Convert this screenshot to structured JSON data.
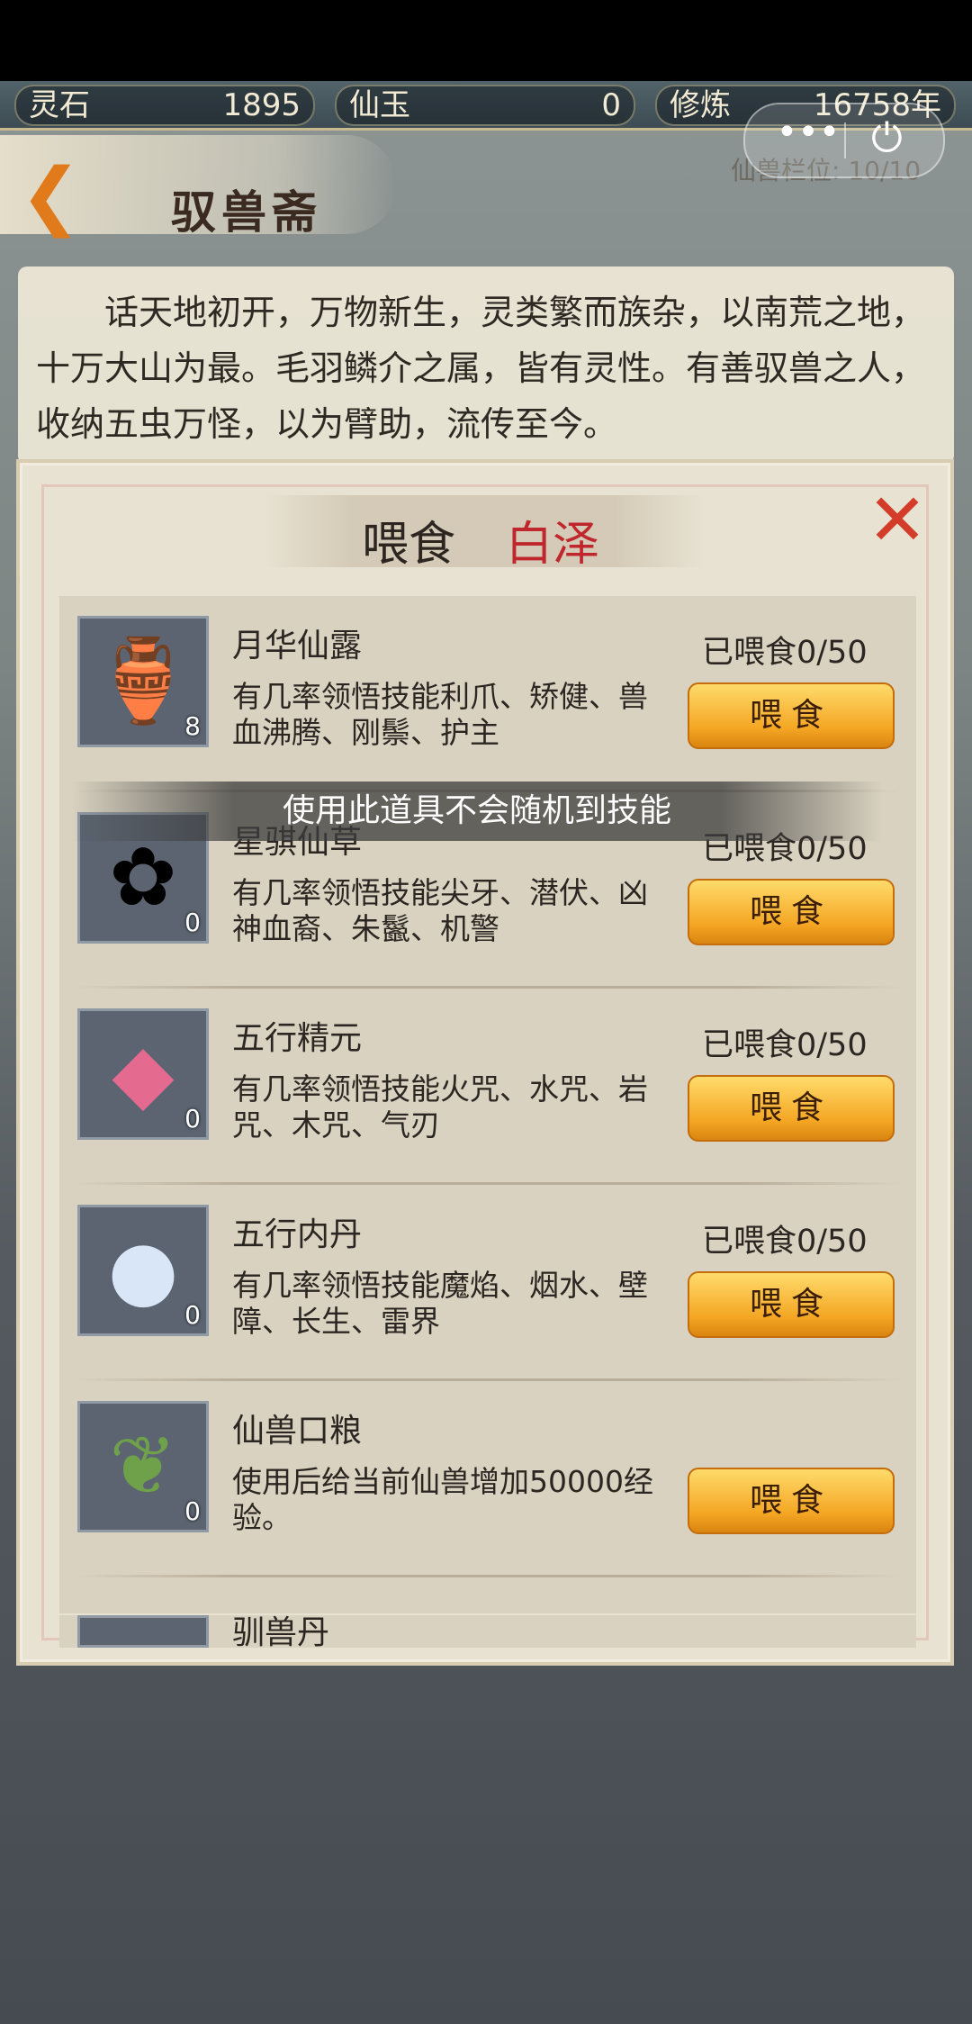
{
  "resources": [
    {
      "label": "灵石",
      "value": "1895"
    },
    {
      "label": "仙玉",
      "value": "0"
    },
    {
      "label": "修炼",
      "value": "16758年"
    }
  ],
  "capsule": {
    "more": "•••",
    "exit": "⏻"
  },
  "header": {
    "title": "驭兽斋",
    "slots": "仙兽栏位: 10/10"
  },
  "intro": "话天地初开，万物新生，灵类繁而族杂，以南荒之地，十万大山为最。毛羽鳞介之属，皆有灵性。有善驭兽之人，收纳五虫万怪，以为臂助，流传至今。",
  "dialog": {
    "title": "喂食",
    "pet_name": "白泽",
    "toast": "使用此道具不会随机到技能",
    "feed_label": "喂食",
    "items": [
      {
        "name": "月华仙露",
        "qty": "8",
        "desc": "有几率领悟技能利爪、矫健、兽血沸腾、刚鬃、护主",
        "fed": "已喂食0/50",
        "icon": "vase-icon"
      },
      {
        "name": "星骐仙草",
        "qty": "0",
        "desc": "有几率领悟技能尖牙、潜伏、凶神血裔、朱鬣、机警",
        "fed": "已喂食0/50",
        "icon": "herb-icon"
      },
      {
        "name": "五行精元",
        "qty": "0",
        "desc": "有几率领悟技能火咒、水咒、岩咒、木咒、气刃",
        "fed": "已喂食0/50",
        "icon": "crystal-icon"
      },
      {
        "name": "五行内丹",
        "qty": "0",
        "desc": "有几率领悟技能魔焰、烟水、壁障、长生、雷界",
        "fed": "已喂食0/50",
        "icon": "orb-icon"
      },
      {
        "name": "仙兽口粮",
        "qty": "0",
        "desc": "使用后给当前仙兽增加50000经验。",
        "fed": "",
        "icon": "leaf-food-icon"
      }
    ],
    "partial_item": {
      "name": "驯兽丹"
    }
  }
}
